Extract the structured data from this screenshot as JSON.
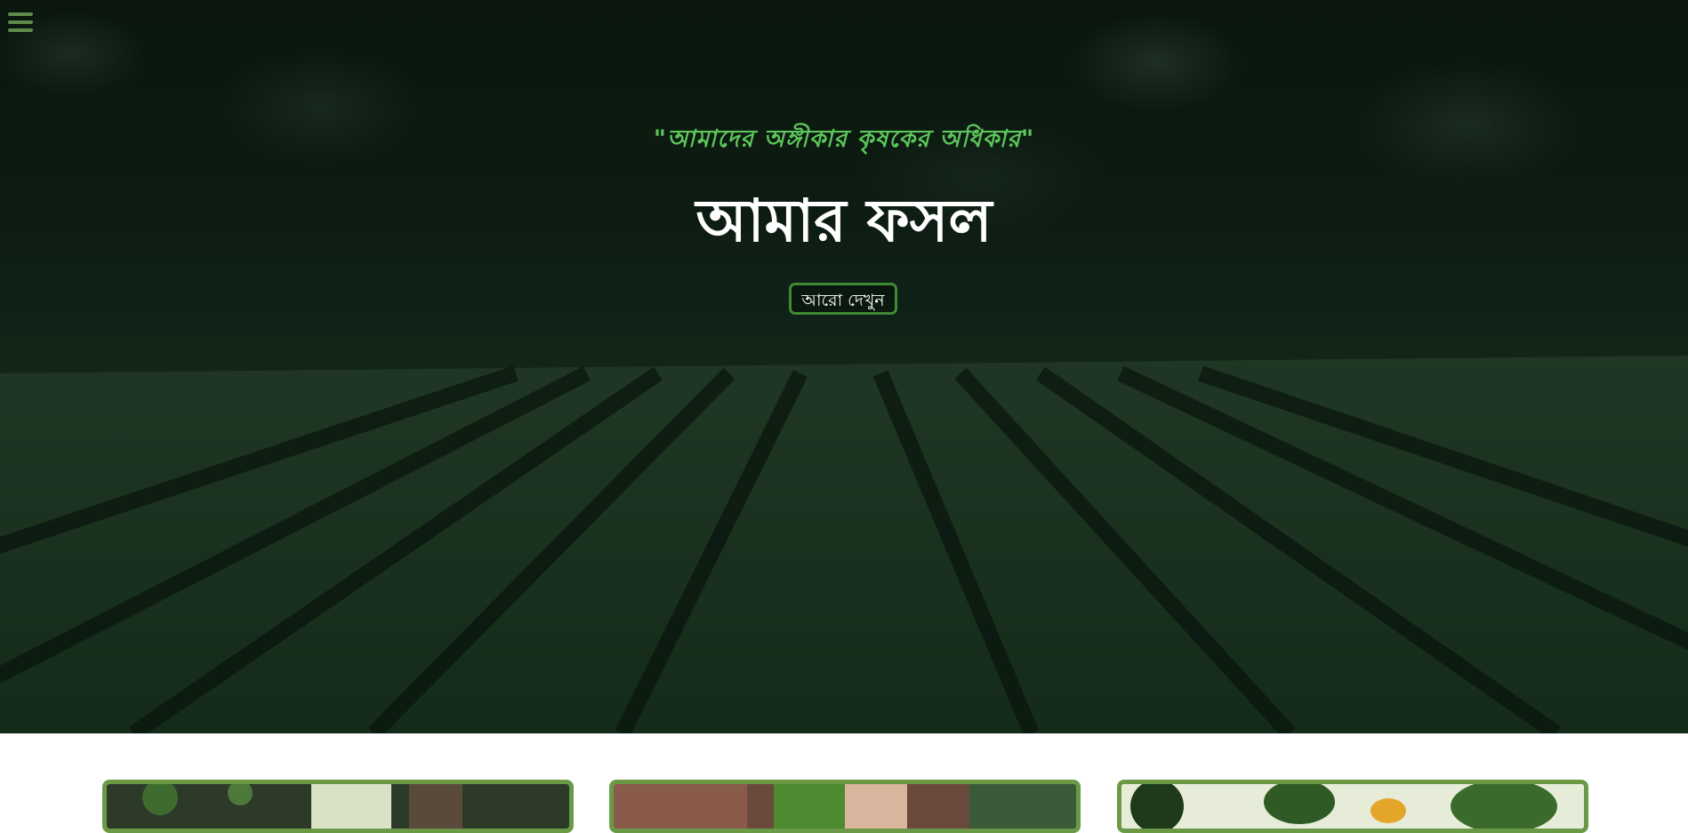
{
  "hero": {
    "tagline": "\"আমাদের অঙ্গীকার কৃষকের অধিকার\"",
    "title": "আমার ফসল",
    "more_button_label": "আরো দেখুন"
  },
  "nav": {
    "menu_icon": "hamburger-menu-icon"
  },
  "cards": [
    {
      "image": "farmer-hands-plants"
    },
    {
      "image": "hand-holding-seedlings"
    },
    {
      "image": "citrus-tree-leaves"
    }
  ],
  "colors": {
    "accent_green": "#5cc65a",
    "button_border": "#3f8a34",
    "card_border": "#6a9a45",
    "menu_icon": "#5e8a4a"
  }
}
